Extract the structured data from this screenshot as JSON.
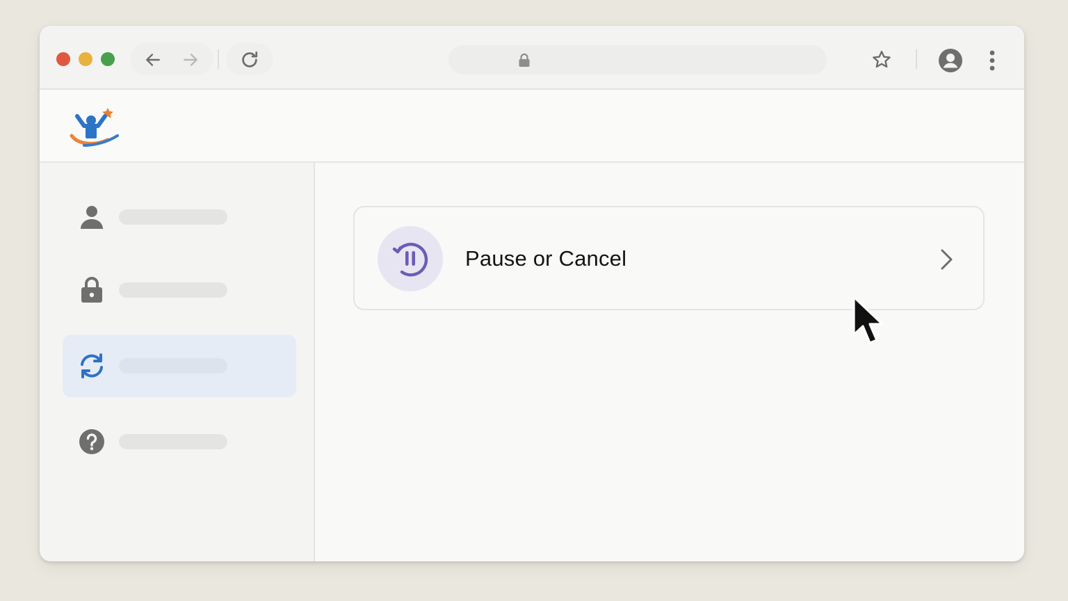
{
  "browser": {
    "controls": {
      "close_color": "#e0583f",
      "minimize_color": "#e9b13d",
      "maximize_color": "#48a04c"
    },
    "icons": {
      "back": "arrow-left-icon",
      "forward": "arrow-right-icon",
      "reload": "reload-icon",
      "secure": "lock-icon",
      "bookmark": "star-icon",
      "profile": "account-circle-icon",
      "menu": "kebab-menu-icon"
    },
    "address": ""
  },
  "header": {
    "logo": "person-with-star-logo",
    "logo_colors": {
      "figure": "#2c74c6",
      "star": "#ee7f2d",
      "swoosh_orange": "#e9843a",
      "swoosh_blue": "#3a7bc8"
    }
  },
  "sidebar": {
    "items": [
      {
        "icon": "person-icon",
        "label": "",
        "active": false
      },
      {
        "icon": "lock-icon",
        "label": "",
        "active": false
      },
      {
        "icon": "sync-icon",
        "label": "",
        "active": true
      },
      {
        "icon": "help-circle-icon",
        "label": "",
        "active": false
      }
    ],
    "active_color": "#2f72c4"
  },
  "main": {
    "card": {
      "title": "Pause or Cancel",
      "icon": "pause-cycle-icon",
      "icon_color": "#6e5bb6",
      "chevron": "chevron-right-icon"
    }
  },
  "cursor": "mouse-pointer-icon"
}
